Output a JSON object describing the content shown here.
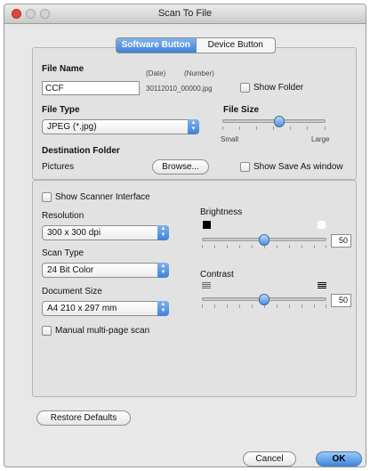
{
  "window": {
    "title": "Scan To File"
  },
  "tabs": [
    {
      "label": "Software Button",
      "selected": true
    },
    {
      "label": "Device Button",
      "selected": false
    }
  ],
  "file_name": {
    "label": "File Name",
    "value": "CCF",
    "date_header": "(Date)",
    "number_header": "(Number)",
    "preview": "30112010_00000.jpg"
  },
  "show_folder": {
    "label": "Show Folder",
    "checked": false
  },
  "file_type": {
    "label": "File Type",
    "value": "JPEG (*.jpg)"
  },
  "file_size": {
    "label": "File Size",
    "min_label": "Small",
    "max_label": "Large",
    "level_percent": 55
  },
  "destination": {
    "label": "Destination Folder",
    "value": "Pictures",
    "browse_label": "Browse..."
  },
  "show_save_as": {
    "label": "Show Save As window",
    "checked": false
  },
  "show_scanner_interface": {
    "label": "Show Scanner Interface",
    "checked": false
  },
  "resolution": {
    "label": "Resolution",
    "value": "300 x 300 dpi"
  },
  "scan_type": {
    "label": "Scan Type",
    "value": "24 Bit Color"
  },
  "document_size": {
    "label": "Document Size",
    "value": "A4  210 x 297 mm"
  },
  "manual_multipage": {
    "label": "Manual multi-page scan",
    "checked": false
  },
  "brightness": {
    "label": "Brightness",
    "value": "50",
    "level_percent": 50
  },
  "contrast": {
    "label": "Contrast",
    "value": "50",
    "level_percent": 50
  },
  "buttons": {
    "restore_defaults": "Restore Defaults",
    "cancel": "Cancel",
    "ok": "OK"
  }
}
